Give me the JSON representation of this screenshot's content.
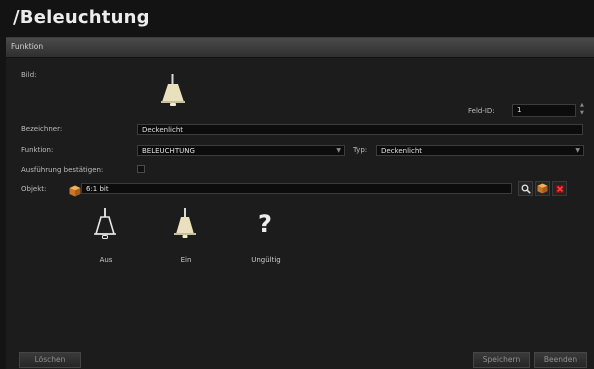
{
  "page": {
    "title": "/Beleuchtung"
  },
  "panel": {
    "header": "Funktion"
  },
  "form": {
    "bild_label": "Bild:",
    "feld_id_label": "Feld-ID:",
    "feld_id_value": "1",
    "bezeichner_label": "Bezeichner:",
    "bezeichner_value": "Deckenlicht",
    "funktion_label": "Funktion:",
    "funktion_value": "BELEUCHTUNG",
    "typ_label": "Typ:",
    "typ_value": "Deckenlicht",
    "ausfuehrung_label": "Ausführung bestätigen:",
    "ausfuehrung_checked": false,
    "objekt_label": "Objekt:",
    "objekt_value": "6:1 bit"
  },
  "states": [
    {
      "label": "Aus",
      "icon": "lamp-off-icon"
    },
    {
      "label": "Ein",
      "icon": "lamp-on-icon"
    },
    {
      "label": "Ungültig",
      "icon": "question-mark-icon"
    }
  ],
  "footer": {
    "delete_label": "Löschen",
    "save_label": "Speichern",
    "close_label": "Beenden"
  },
  "colors": {
    "background": "#141414",
    "panel": "#1c1c1c",
    "lamp": "#e9e0bd",
    "object_cube": "#d88a2e",
    "remove": "#cc2222"
  }
}
